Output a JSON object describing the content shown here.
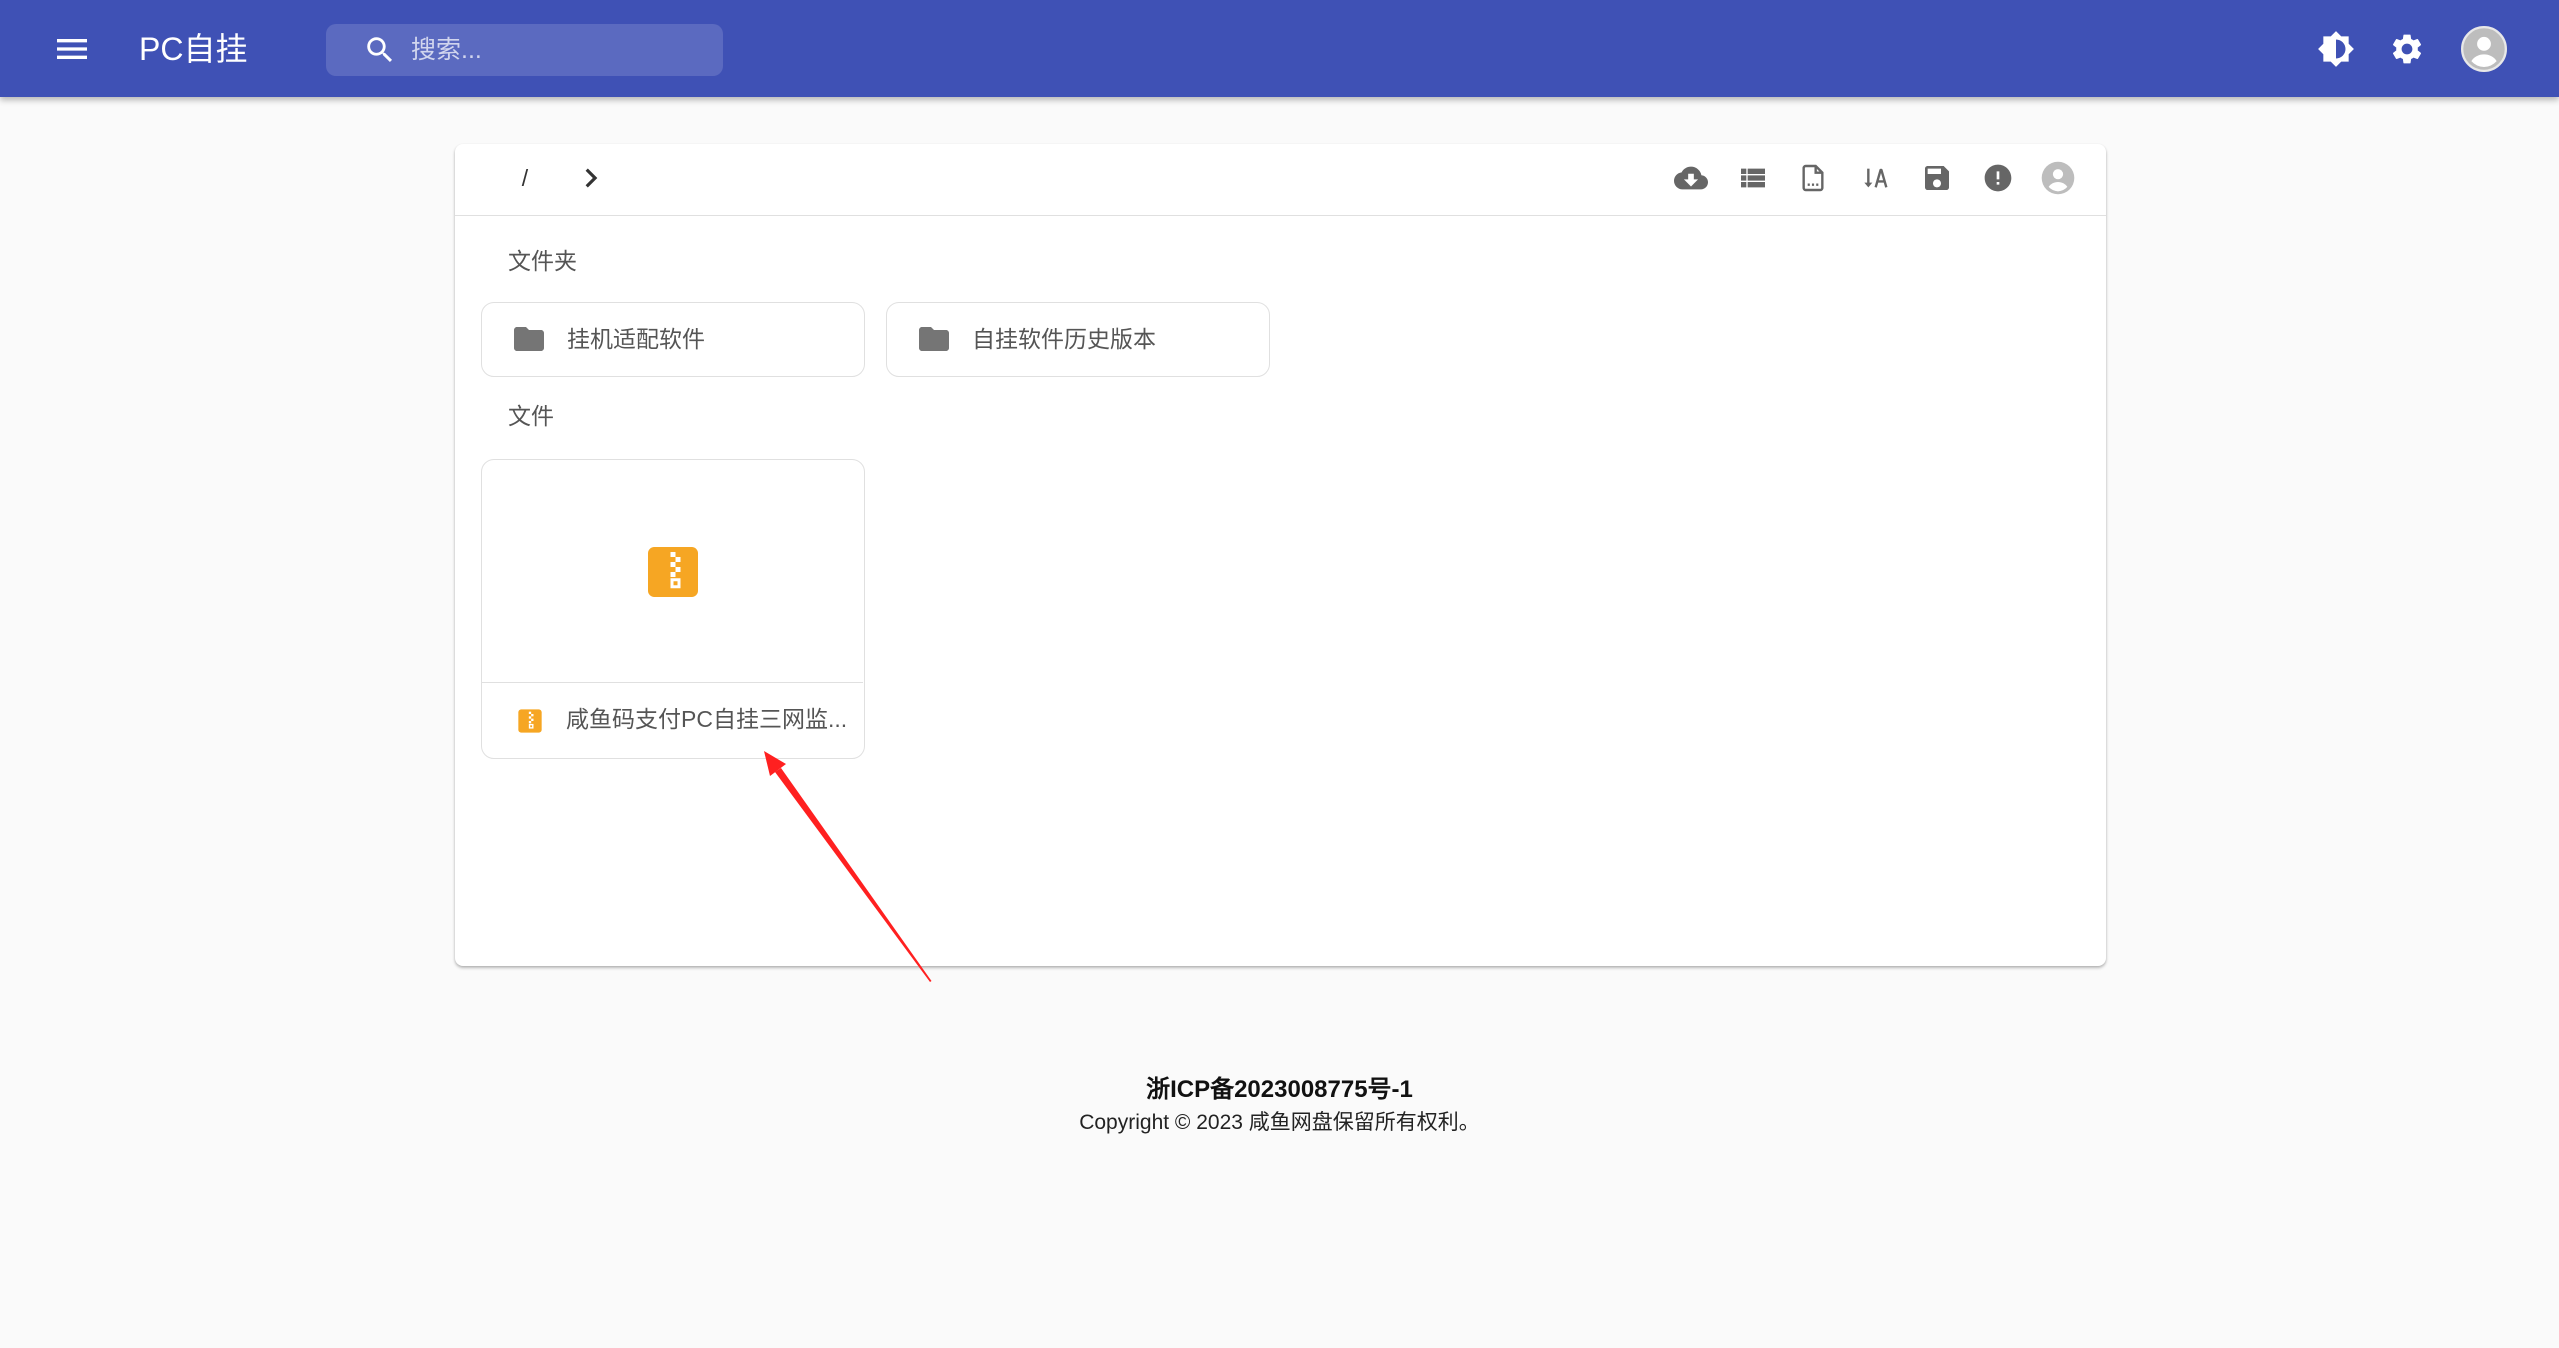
{
  "app_bar": {
    "title": "PC自挂",
    "search_placeholder": "搜索...",
    "icons": [
      "menu-icon",
      "search-icon",
      "brightness-icon",
      "settings-icon",
      "account-avatar-icon"
    ]
  },
  "toolbar": {
    "breadcrumb_root": "/",
    "actions": [
      "cloud-download-icon",
      "view-list-icon",
      "document-icon",
      "sort-by-alpha-icon",
      "save-icon",
      "error-icon",
      "account-avatar-icon"
    ]
  },
  "sections": {
    "folders_label": "文件夹",
    "files_label": "文件"
  },
  "folders": [
    {
      "name": "挂机适配软件",
      "icon": "folder-icon"
    },
    {
      "name": "自挂软件历史版本",
      "icon": "folder-icon"
    }
  ],
  "files": [
    {
      "name": "咸鱼码支付PC自挂三网监...",
      "icon": "zip-archive-icon"
    }
  ],
  "footer": {
    "icp": "浙ICP备2023008775号-1",
    "copyright": "Copyright © 2023 咸鱼网盘保留所有权利。"
  },
  "colors": {
    "app_bar": "#3f51b5",
    "page_background": "#fafafa",
    "icon_gray": "#666666",
    "zip_icon": "#f6a623",
    "annotation_arrow": "#ff2020"
  }
}
